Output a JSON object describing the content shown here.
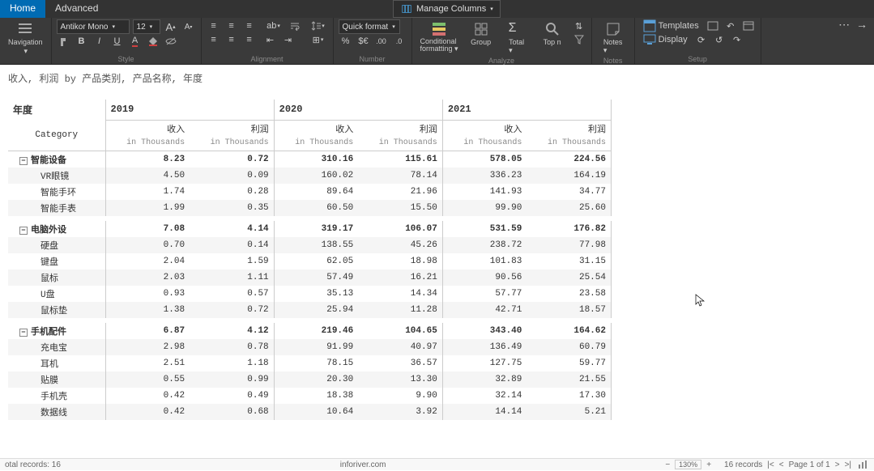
{
  "tabs": {
    "home": "Home",
    "advanced": "Advanced"
  },
  "manage_columns": "Manage Columns",
  "ribbon": {
    "navigation": "Navigation",
    "font_family": "Antikor Mono",
    "font_size": "12",
    "style_label": "Style",
    "alignment_label": "Alignment",
    "number_label": "Number",
    "analyze_label": "Analyze",
    "notes_label": "Notes",
    "setup_label": "Setup",
    "quick_format": "Quick format",
    "conditional_formatting": "Conditional formatting",
    "group": "Group",
    "total": "Total",
    "topn": "Top n",
    "notes": "Notes",
    "templates": "Templates",
    "display": "Display"
  },
  "title": "收入, 利润 by 产品类别, 产品名称, 年度",
  "year_label": "年度",
  "category_label": "Category",
  "years": [
    "2019",
    "2020",
    "2021"
  ],
  "measures": [
    "收入",
    "利润"
  ],
  "unit": "in Thousands",
  "rows": [
    {
      "type": "group",
      "label": "智能设备",
      "vals": [
        "8.23",
        "0.72",
        "310.16",
        "115.61",
        "578.05",
        "224.56"
      ]
    },
    {
      "type": "item",
      "label": "VR眼镜",
      "vals": [
        "4.50",
        "0.09",
        "160.02",
        "78.14",
        "336.23",
        "164.19"
      ],
      "alt": true
    },
    {
      "type": "item",
      "label": "智能手环",
      "vals": [
        "1.74",
        "0.28",
        "89.64",
        "21.96",
        "141.93",
        "34.77"
      ]
    },
    {
      "type": "item",
      "label": "智能手表",
      "vals": [
        "1.99",
        "0.35",
        "60.50",
        "15.50",
        "99.90",
        "25.60"
      ],
      "alt": true
    },
    {
      "type": "spacer"
    },
    {
      "type": "group",
      "label": "电脑外设",
      "vals": [
        "7.08",
        "4.14",
        "319.17",
        "106.07",
        "531.59",
        "176.82"
      ]
    },
    {
      "type": "item",
      "label": "硬盘",
      "vals": [
        "0.70",
        "0.14",
        "138.55",
        "45.26",
        "238.72",
        "77.98"
      ],
      "alt": true
    },
    {
      "type": "item",
      "label": "键盘",
      "vals": [
        "2.04",
        "1.59",
        "62.05",
        "18.98",
        "101.83",
        "31.15"
      ]
    },
    {
      "type": "item",
      "label": "鼠标",
      "vals": [
        "2.03",
        "1.11",
        "57.49",
        "16.21",
        "90.56",
        "25.54"
      ],
      "alt": true
    },
    {
      "type": "item",
      "label": "U盘",
      "vals": [
        "0.93",
        "0.57",
        "35.13",
        "14.34",
        "57.77",
        "23.58"
      ]
    },
    {
      "type": "item",
      "label": "鼠标垫",
      "vals": [
        "1.38",
        "0.72",
        "25.94",
        "11.28",
        "42.71",
        "18.57"
      ],
      "alt": true
    },
    {
      "type": "spacer"
    },
    {
      "type": "group",
      "label": "手机配件",
      "vals": [
        "6.87",
        "4.12",
        "219.46",
        "104.65",
        "343.40",
        "164.62"
      ]
    },
    {
      "type": "item",
      "label": "充电宝",
      "vals": [
        "2.98",
        "0.78",
        "91.99",
        "40.97",
        "136.49",
        "60.79"
      ],
      "alt": true
    },
    {
      "type": "item",
      "label": "耳机",
      "vals": [
        "2.51",
        "1.18",
        "78.15",
        "36.57",
        "127.75",
        "59.77"
      ]
    },
    {
      "type": "item",
      "label": "贴膜",
      "vals": [
        "0.55",
        "0.99",
        "20.30",
        "13.30",
        "32.89",
        "21.55"
      ],
      "alt": true
    },
    {
      "type": "item",
      "label": "手机壳",
      "vals": [
        "0.42",
        "0.49",
        "18.38",
        "9.90",
        "32.14",
        "17.30"
      ]
    },
    {
      "type": "item",
      "label": "数据线",
      "vals": [
        "0.42",
        "0.68",
        "10.64",
        "3.92",
        "14.14",
        "5.21"
      ],
      "alt": true
    }
  ],
  "status": {
    "total_records": "otal records: 16",
    "site": "inforiver.com",
    "records": "16 records",
    "page": "Page 1 of 1",
    "zoom": "130%"
  }
}
